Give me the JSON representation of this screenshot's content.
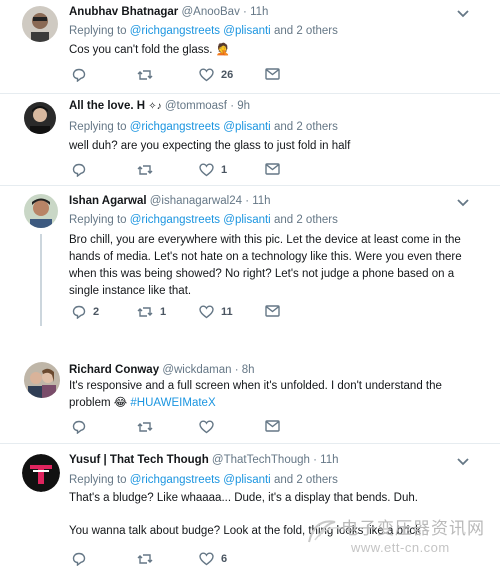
{
  "colors": {
    "link": "#1b95e0",
    "meta": "#657786",
    "text": "#14171a",
    "like_pink": "#e0245e"
  },
  "tweets": [
    {
      "name": "Anubhav Bhatnagar",
      "handle": "@AnooBav",
      "sep": "·",
      "time": "11h",
      "reply_prefix": "Replying to",
      "mention1": "@richgangstreets",
      "mention2": "@plisanti",
      "reply_suffix": "and 2 others",
      "text": "Cos you can't fold the glass.",
      "emoji": "🤦",
      "reply_count": "",
      "retweet_count": "",
      "like_count": "26"
    },
    {
      "name": "All the love. H",
      "name_suffix": "✧♪",
      "handle": "@tommoasf",
      "sep": "·",
      "time": "9h",
      "reply_prefix": "Replying to",
      "mention1": "@richgangstreets",
      "mention2": "@plisanti",
      "reply_suffix": "and 2 others",
      "text": "well duh? are you expecting the glass to just fold in half",
      "reply_count": "",
      "retweet_count": "",
      "like_count": "1"
    },
    {
      "name": "Ishan Agarwal",
      "handle": "@ishanagarwal24",
      "sep": "·",
      "time": "11h",
      "reply_prefix": "Replying to",
      "mention1": "@richgangstreets",
      "mention2": "@plisanti",
      "reply_suffix": "and 2 others",
      "lines": [
        "Bro chill, you are everywhere with this pic. Let the device at least come in the",
        "hands of media. Let's not hate on a technology like this. Were you even there",
        "when this was being showed? No right? Let's not judge a phone based on a",
        "single instance like that."
      ],
      "reply_count": "2",
      "retweet_count": "1",
      "like_count": "11"
    },
    {
      "name": "Richard Conway",
      "handle": "@wickdaman",
      "sep": "·",
      "time": "8h",
      "line1": "It's responsive and a full screen when it's unfolded. I don't understand the",
      "line2": "problem",
      "emoji": "😂",
      "hashtag": "#HUAWEIMateX",
      "reply_count": "",
      "retweet_count": "",
      "like_count": ""
    },
    {
      "name": "Yusuf | That Tech Though",
      "handle": "@ThatTechThough",
      "sep": "·",
      "time": "11h",
      "reply_prefix": "Replying to",
      "mention1": "@richgangstreets",
      "mention2": "@plisanti",
      "reply_suffix": "and 2 others",
      "line1": "That's a bludge? Like whaaaa... Dude, it's a display that bends. Duh.",
      "line2": "You wanna talk about budge? Look at the fold, thing looks like a brick",
      "reply_count": "",
      "retweet_count": "",
      "like_count": "6"
    }
  ],
  "watermark": {
    "cn": "电子变压器资讯网",
    "url": "www.ett-cn.com"
  }
}
